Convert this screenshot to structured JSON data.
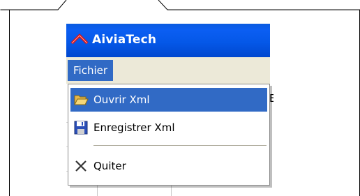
{
  "window": {
    "title": "AiviaTech",
    "logo_icon": "aiviatech-logo-icon",
    "titlebar_color": "#0558e8"
  },
  "menubar": {
    "items": [
      {
        "label": "Fichier",
        "active": true
      }
    ]
  },
  "dropdown": {
    "items": [
      {
        "label": "Ouvrir Xml",
        "icon": "open-folder-icon",
        "highlighted": true
      },
      {
        "label": "Enregistrer Xml",
        "icon": "floppy-disk-icon",
        "highlighted": false
      },
      {
        "label": "Quiter",
        "icon": "close-x-icon",
        "highlighted": false
      }
    ]
  },
  "background": {
    "partial_text": "E"
  },
  "colors": {
    "highlight": "#316ac5",
    "menu_background": "#ece9d8",
    "logo_red": "#e01010"
  }
}
